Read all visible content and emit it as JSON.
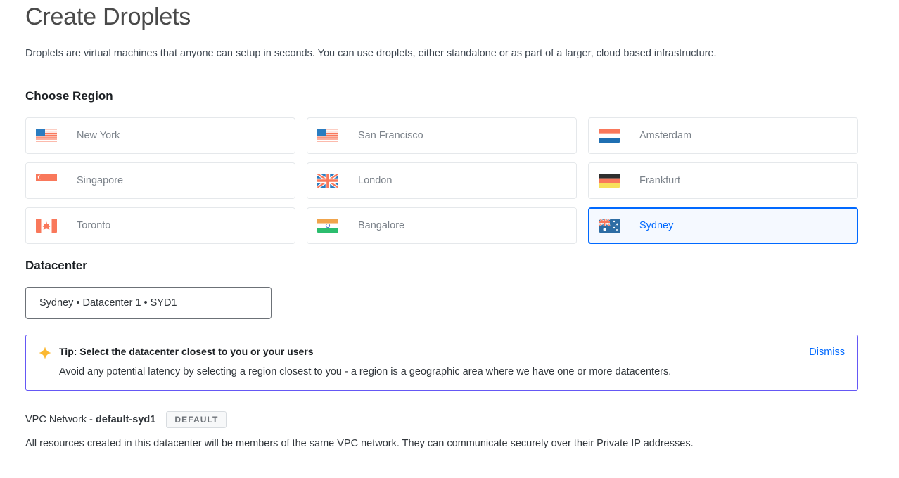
{
  "header": {
    "title": "Create Droplets",
    "subtitle": "Droplets are virtual machines that anyone can setup in seconds. You can use droplets, either standalone or as part of a larger, cloud based infrastructure."
  },
  "region_section": {
    "heading": "Choose Region",
    "regions": [
      {
        "label": "New York",
        "flag": "flag-us",
        "selected": false
      },
      {
        "label": "San Francisco",
        "flag": "flag-us",
        "selected": false
      },
      {
        "label": "Amsterdam",
        "flag": "flag-nl",
        "selected": false
      },
      {
        "label": "Singapore",
        "flag": "flag-sg",
        "selected": false
      },
      {
        "label": "London",
        "flag": "flag-gb",
        "selected": false
      },
      {
        "label": "Frankfurt",
        "flag": "flag-de",
        "selected": false
      },
      {
        "label": "Toronto",
        "flag": "flag-ca",
        "selected": false
      },
      {
        "label": "Bangalore",
        "flag": "flag-in",
        "selected": false
      },
      {
        "label": "Sydney",
        "flag": "flag-au",
        "selected": true
      }
    ]
  },
  "datacenter_section": {
    "heading": "Datacenter",
    "selected_value": "Sydney • Datacenter 1 • SYD1"
  },
  "tip": {
    "icon": "sparkle-star-icon",
    "title": "Tip: Select the datacenter closest to you or your users",
    "text": "Avoid any potential latency by selecting a region closest to you - a region is a geographic area where we have one or more datacenters.",
    "dismiss_label": "Dismiss"
  },
  "vpc": {
    "label_prefix": "VPC Network - ",
    "network_name": "default-syd1",
    "badge": "DEFAULT",
    "description": "All resources created in this datacenter will be members of the same VPC network. They can communicate securely over their Private IP addresses."
  },
  "colors": {
    "accent_blue": "#0069ff",
    "selected_card_bg": "#f5f9ff",
    "tip_border_purple": "#6558f5",
    "tip_star_gold": "#fbb832",
    "flag_coral": "#f9785b",
    "flag_blue": "#2b7cc0",
    "card_border": "#e5e8eb"
  }
}
